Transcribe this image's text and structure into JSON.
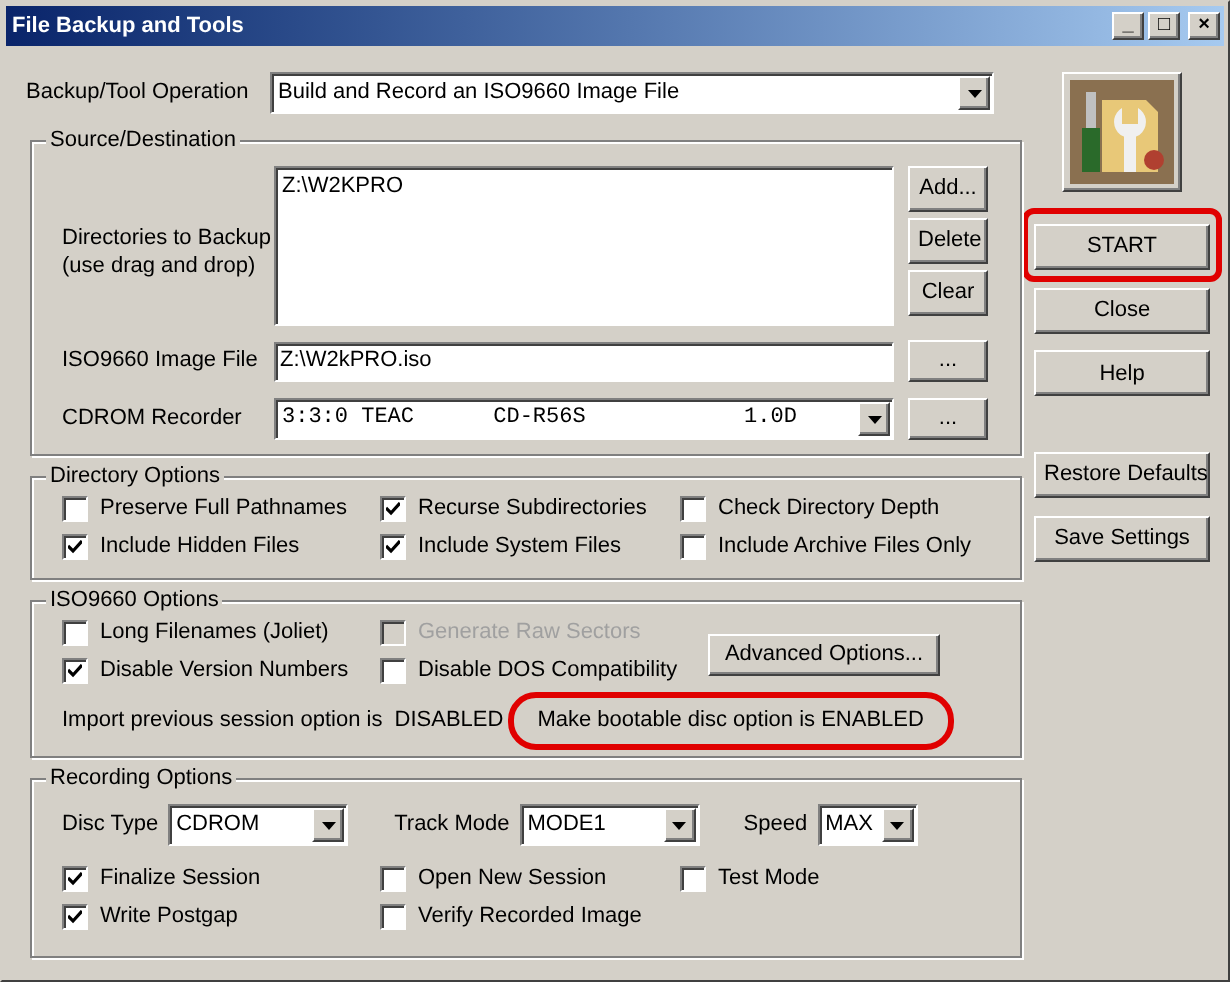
{
  "window": {
    "title": "File Backup and Tools",
    "controls": [
      "_",
      "□",
      "×"
    ]
  },
  "operation": {
    "label": "Backup/Tool Operation",
    "value": "Build and Record an ISO9660 Image File"
  },
  "source_destination": {
    "title": "Source/Destination",
    "directories_label": [
      "Directories to Backup",
      "(use drag and drop)"
    ],
    "directories": [
      "Z:\\W2KPRO"
    ],
    "directory_buttons": [
      "Add...",
      "Delete",
      "Clear"
    ],
    "image_file": {
      "label": "ISO9660 Image File",
      "value": "Z:\\W2kPRO.iso",
      "browse": "..."
    },
    "recorder": {
      "label": "CDROM Recorder",
      "value": "3:3:0 TEAC      CD-R56S            1.0D",
      "browse": "..."
    }
  },
  "directory_options": {
    "title": "Directory Options",
    "options": [
      {
        "label": "Preserve Full Pathnames",
        "checked": false
      },
      {
        "label": "Recurse Subdirectories",
        "checked": true
      },
      {
        "label": "Check Directory Depth",
        "checked": false
      },
      {
        "label": "Include Hidden Files",
        "checked": true
      },
      {
        "label": "Include System Files",
        "checked": true
      },
      {
        "label": "Include Archive Files Only",
        "checked": false
      }
    ]
  },
  "iso_options": {
    "title": "ISO9660 Options",
    "options": [
      {
        "label": "Long Filenames (Joliet)",
        "checked": false,
        "disabled": false
      },
      {
        "label": "Generate Raw Sectors",
        "checked": false,
        "disabled": true
      },
      {
        "label": "Disable Version Numbers",
        "checked": true,
        "disabled": false
      },
      {
        "label": "Disable DOS Compatibility",
        "checked": false,
        "disabled": false
      }
    ],
    "advanced_button": "Advanced Options...",
    "import_status": "Import previous session option is  DISABLED",
    "bootable_status": {
      "text": "Make bootable disc option is ENABLED",
      "highlighted": true
    }
  },
  "recording_options": {
    "title": "Recording Options",
    "disc_type": {
      "label": "Disc Type",
      "value": "CDROM"
    },
    "track_mode": {
      "label": "Track Mode",
      "value": "MODE1"
    },
    "speed": {
      "label": "Speed",
      "value": "MAX"
    },
    "options": [
      {
        "label": "Finalize Session",
        "checked": true
      },
      {
        "label": "Open New Session",
        "checked": false
      },
      {
        "label": "Test Mode",
        "checked": false
      },
      {
        "label": "Write Postgap",
        "checked": true
      },
      {
        "label": "Verify Recorded Image",
        "checked": false
      }
    ]
  },
  "side_buttons": [
    {
      "label": "START",
      "highlighted": true
    },
    {
      "label": "Close",
      "highlighted": false
    },
    {
      "label": "Help",
      "highlighted": false
    },
    {
      "label": "Restore Defaults",
      "highlighted": false
    },
    {
      "label": "Save Settings",
      "highlighted": false
    }
  ]
}
